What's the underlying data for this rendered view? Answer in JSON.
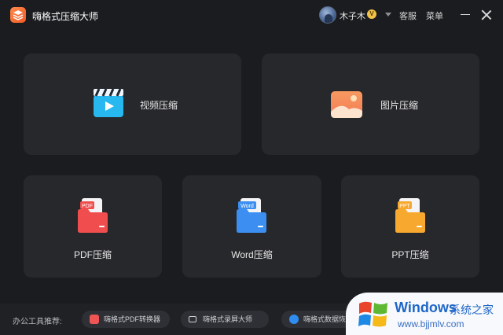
{
  "app": {
    "title": "嗨格式压缩大师",
    "logo_icon": "layers-icon",
    "brand_color": "#f15a24"
  },
  "header": {
    "username": "木子木",
    "vip_badge": "V",
    "service_label": "客服",
    "menu_label": "菜单"
  },
  "cards": {
    "video": {
      "label": "视频压缩",
      "icon": "video-clapper-icon"
    },
    "image": {
      "label": "图片压缩",
      "icon": "image-landscape-icon"
    },
    "pdf": {
      "label": "PDF压缩",
      "badge": "PDF",
      "icon": "pdf-folder-icon"
    },
    "word": {
      "label": "Word压缩",
      "badge": "Word",
      "icon": "word-folder-icon"
    },
    "ppt": {
      "label": "PPT压缩",
      "badge": "PPT",
      "icon": "ppt-folder-icon"
    }
  },
  "footer": {
    "label": "办公工具推荐:",
    "tools": [
      {
        "label": "嗨格式PDF转换器",
        "icon": "pdf-converter-icon"
      },
      {
        "label": "嗨格式录屏大师",
        "icon": "camera-icon"
      },
      {
        "label": "嗨格式数据恢",
        "icon": "data-recovery-icon"
      }
    ]
  },
  "watermark": {
    "title": "Windows",
    "subtitle": "系统之家",
    "url": "www.bjjmlv.com",
    "icon": "windows-logo-icon"
  },
  "colors": {
    "background": "#1b1c1f",
    "card": "#27282c",
    "video": "#27b8f0",
    "image": "#f08a55",
    "pdf": "#f04e4e",
    "word": "#3c8ff0",
    "ppt": "#f7a82e"
  }
}
